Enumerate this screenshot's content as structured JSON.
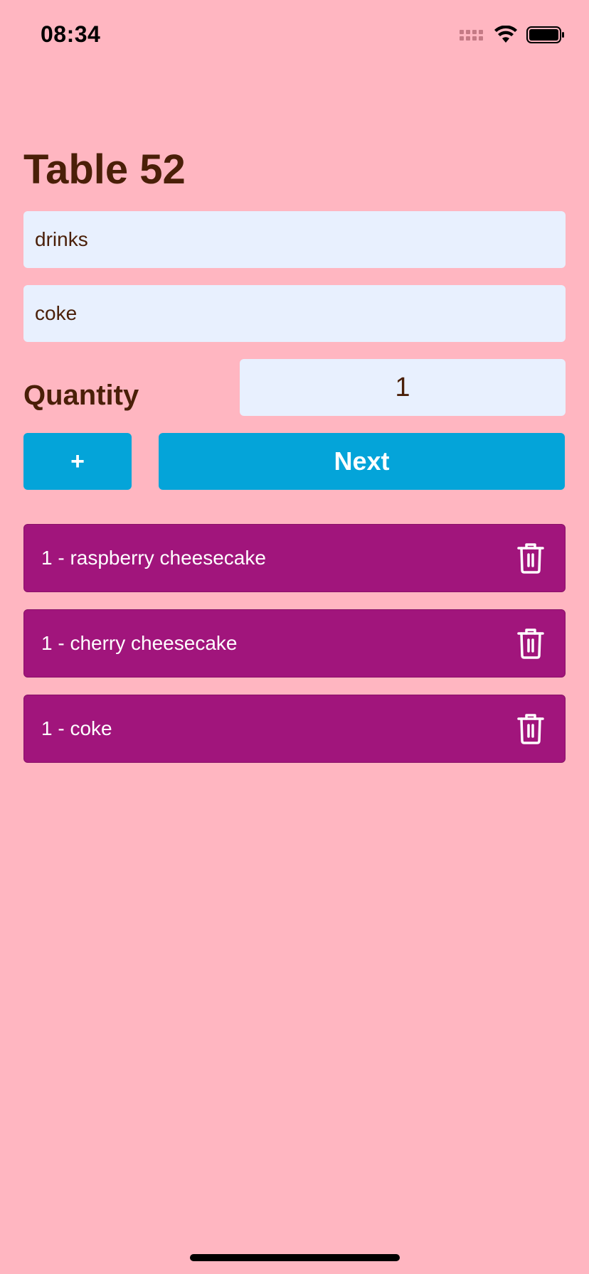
{
  "status_bar": {
    "time": "08:34",
    "icons": [
      "signal-icon",
      "wifi-icon",
      "battery-icon"
    ]
  },
  "header": {
    "title": "Table 52"
  },
  "form": {
    "category_value": "drinks",
    "item_value": "coke",
    "quantity_label": "Quantity",
    "quantity_value": "1",
    "plus_label": "+",
    "next_label": "Next"
  },
  "order": {
    "items": [
      {
        "label": "1 - raspberry cheesecake",
        "icon": "trash-icon"
      },
      {
        "label": "1 - cherry cheesecake",
        "icon": "trash-icon"
      },
      {
        "label": "1 - coke",
        "icon": "trash-icon"
      }
    ]
  },
  "colors": {
    "background": "#FFB6C1",
    "title_text": "#4a1f08",
    "field_background": "#E8F0FE",
    "button_background": "#04A4D9",
    "order_item_background": "#A1157C"
  }
}
